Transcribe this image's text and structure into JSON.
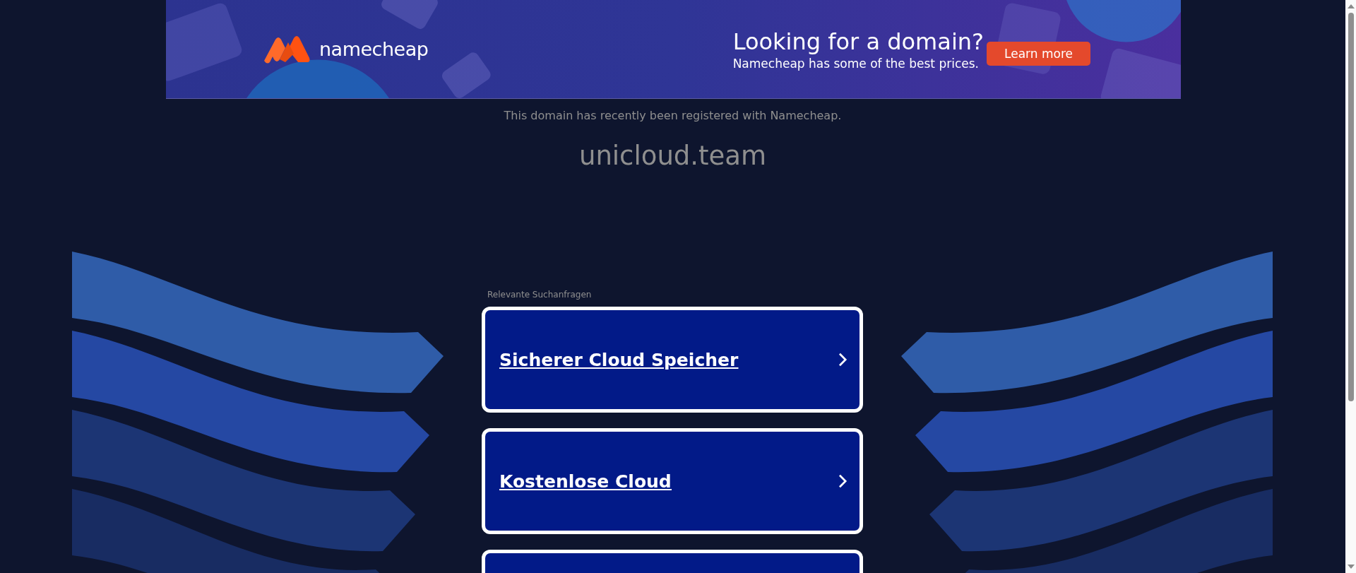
{
  "banner": {
    "logo": "namecheap",
    "headline": "Looking for a domain?",
    "subline": "Namecheap has some of the best prices.",
    "button": "Learn more"
  },
  "notice": "This domain has recently been registered with Namecheap.",
  "domain": "unicloud.team",
  "related": {
    "label": "Relevante Suchanfragen",
    "links": [
      {
        "title": "Sicherer Cloud Speicher"
      },
      {
        "title": "Kostenlose Cloud"
      }
    ]
  }
}
